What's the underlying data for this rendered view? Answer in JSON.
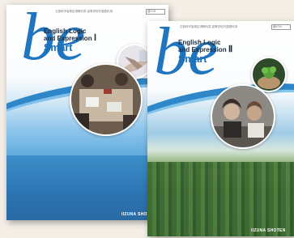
{
  "books": [
    {
      "top_note": "文部科学省検定済教科書 高等学校外国語科用",
      "code": "論Ⅰ706",
      "logo": "be",
      "title_line1": "English Logic",
      "title_line2": "and Expression",
      "level": "Ⅰ",
      "subtitle": "Smart",
      "publisher": "IIZUNA SHOTEN"
    },
    {
      "top_note": "文部科学省検定済教科書 高等学校外国語科用",
      "code": "論Ⅱ706",
      "logo": "be",
      "title_line1": "English Logic",
      "title_line2": "and Expression",
      "level": "Ⅱ",
      "subtitle": "Smart",
      "publisher": "IIZUNA SHOTEN"
    }
  ]
}
